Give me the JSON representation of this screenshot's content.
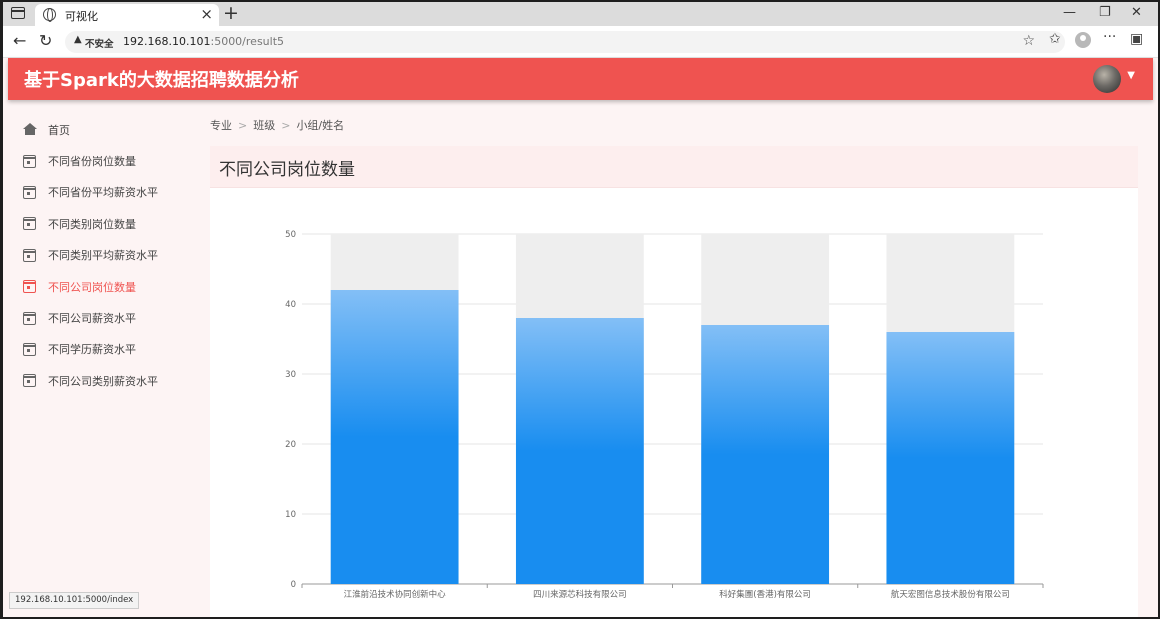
{
  "browser": {
    "tab_title": "可视化",
    "security_label": "不安全",
    "url_host": "192.168.10.101",
    "url_rest": ":5000/result5",
    "status_url": "192.168.10.101:5000/index"
  },
  "app": {
    "title": "基于Spark的大数据招聘数据分析"
  },
  "sidebar": {
    "items": [
      {
        "label": "首页",
        "icon": "home-icon",
        "active": false
      },
      {
        "label": "不同省份岗位数量",
        "icon": "calendar-icon",
        "active": false
      },
      {
        "label": "不同省份平均薪资水平",
        "icon": "calendar-icon",
        "active": false
      },
      {
        "label": "不同类别岗位数量",
        "icon": "calendar-icon",
        "active": false
      },
      {
        "label": "不同类别平均薪资水平",
        "icon": "calendar-icon",
        "active": false
      },
      {
        "label": "不同公司岗位数量",
        "icon": "calendar-icon",
        "active": true
      },
      {
        "label": "不同公司薪资水平",
        "icon": "calendar-icon",
        "active": false
      },
      {
        "label": "不同学历薪资水平",
        "icon": "calendar-icon",
        "active": false
      },
      {
        "label": "不同公司类别薪资水平",
        "icon": "calendar-icon",
        "active": false
      }
    ]
  },
  "breadcrumb": {
    "items": [
      "专业",
      "班级",
      "小组/姓名"
    ],
    "separator": ">"
  },
  "card": {
    "title": "不同公司岗位数量"
  },
  "colors": {
    "header": "#ef5350",
    "active": "#ef5350",
    "bar_top": "#83bff6",
    "bar_mid": "#188df0",
    "bar_bg": "#eeeeee"
  },
  "chart_data": {
    "type": "bar",
    "categories": [
      "江淮前沿技术协同创新中心",
      "四川来源芯科技有限公司",
      "科好集團(香港)有限公司",
      "航天宏图信息技术股份有限公司"
    ],
    "values": [
      42,
      38,
      37,
      36
    ],
    "background_max": 50,
    "ylim": [
      0,
      50
    ],
    "yticks": [
      0,
      10,
      20,
      30,
      40,
      50
    ],
    "grid": true
  }
}
